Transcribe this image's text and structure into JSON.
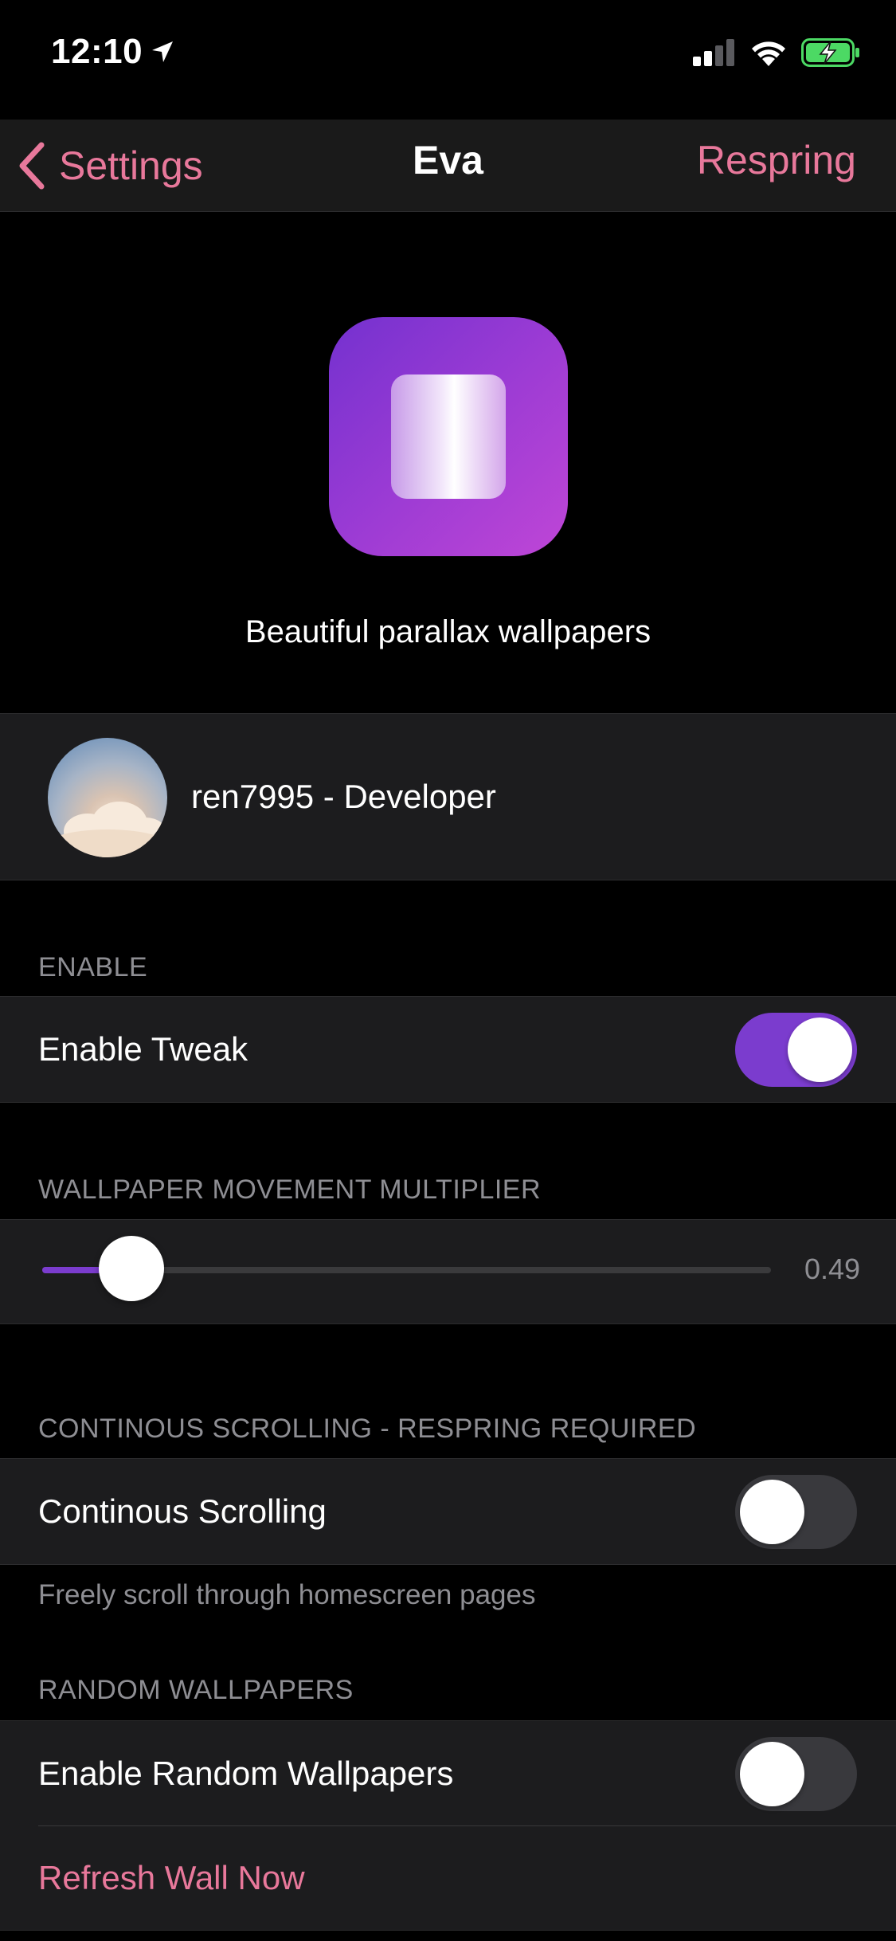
{
  "status_bar": {
    "time": "12:10",
    "icons": [
      "location-arrow-icon",
      "signal-icon",
      "wifi-icon",
      "battery-charging-icon"
    ]
  },
  "nav": {
    "back_label": "Settings",
    "title": "Eva",
    "right_action": "Respring"
  },
  "header": {
    "tagline": "Beautiful parallax wallpapers"
  },
  "developer": {
    "name": "ren7995 - Developer"
  },
  "sections": {
    "enable": {
      "header": "ENABLE",
      "toggle_label": "Enable Tweak",
      "toggle_on": true
    },
    "movement": {
      "header": "WALLPAPER MOVEMENT MULTIPLIER",
      "slider_value": 0.49,
      "slider_value_text": "0.49"
    },
    "continuous": {
      "header": "CONTINOUS SCROLLING - RESPRING REQUIRED",
      "toggle_label": "Continous Scrolling",
      "toggle_on": false,
      "footer": "Freely scroll through homescreen pages"
    },
    "random": {
      "header": "RANDOM WALLPAPERS",
      "toggle_label": "Enable Random Wallpapers",
      "toggle_on": false,
      "link_label": "Refresh Wall Now"
    }
  },
  "colors": {
    "accent_pink": "#e8789b",
    "accent_purple": "#7b3cce",
    "background": "#000000",
    "cell_background": "#1c1c1e",
    "secondary_text": "#8e8e93"
  }
}
